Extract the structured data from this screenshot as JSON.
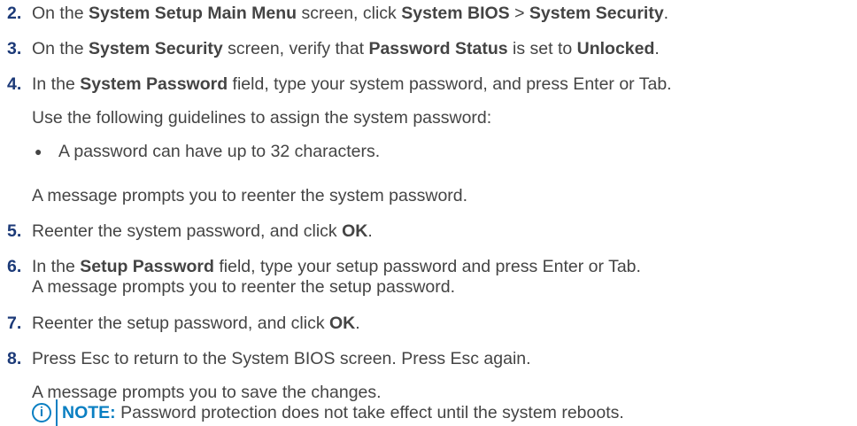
{
  "steps": [
    {
      "number": "2.",
      "parts": [
        "On the ",
        "System Setup Main Menu",
        " screen, click ",
        "System BIOS",
        " > ",
        "System Security",
        "."
      ]
    },
    {
      "number": "3.",
      "parts": [
        "On the ",
        "System Security",
        " screen, verify that ",
        "Password Status",
        " is set to ",
        "Unlocked",
        "."
      ]
    },
    {
      "number": "4.",
      "parts": [
        "In the ",
        "System Password",
        " field, type your system password, and press Enter or Tab."
      ],
      "guideline_intro": "Use the following guidelines to assign the system password:",
      "bullet": "A password can have up to 32 characters.",
      "followup": "A message prompts you to reenter the system password."
    },
    {
      "number": "5.",
      "parts": [
        "Reenter the system password, and click ",
        "OK",
        "."
      ]
    },
    {
      "number": "6.",
      "parts": [
        "In the ",
        "Setup Password",
        " field, type your setup password and press Enter or Tab."
      ],
      "continuation": "A message prompts you to reenter the setup password."
    },
    {
      "number": "7.",
      "parts": [
        "Reenter the setup password, and click ",
        "OK",
        "."
      ]
    },
    {
      "number": "8.",
      "parts": [
        "Press Esc to return to the System BIOS screen. Press Esc again."
      ],
      "followup": "A message prompts you to save the changes."
    }
  ],
  "note": {
    "label": "NOTE:",
    "text": " Password protection does not take effect until the system reboots.",
    "icon": "info-icon"
  },
  "colors": {
    "step_number": "#1c3a78",
    "body_text": "#444444",
    "note_accent": "#0a7fc2"
  }
}
